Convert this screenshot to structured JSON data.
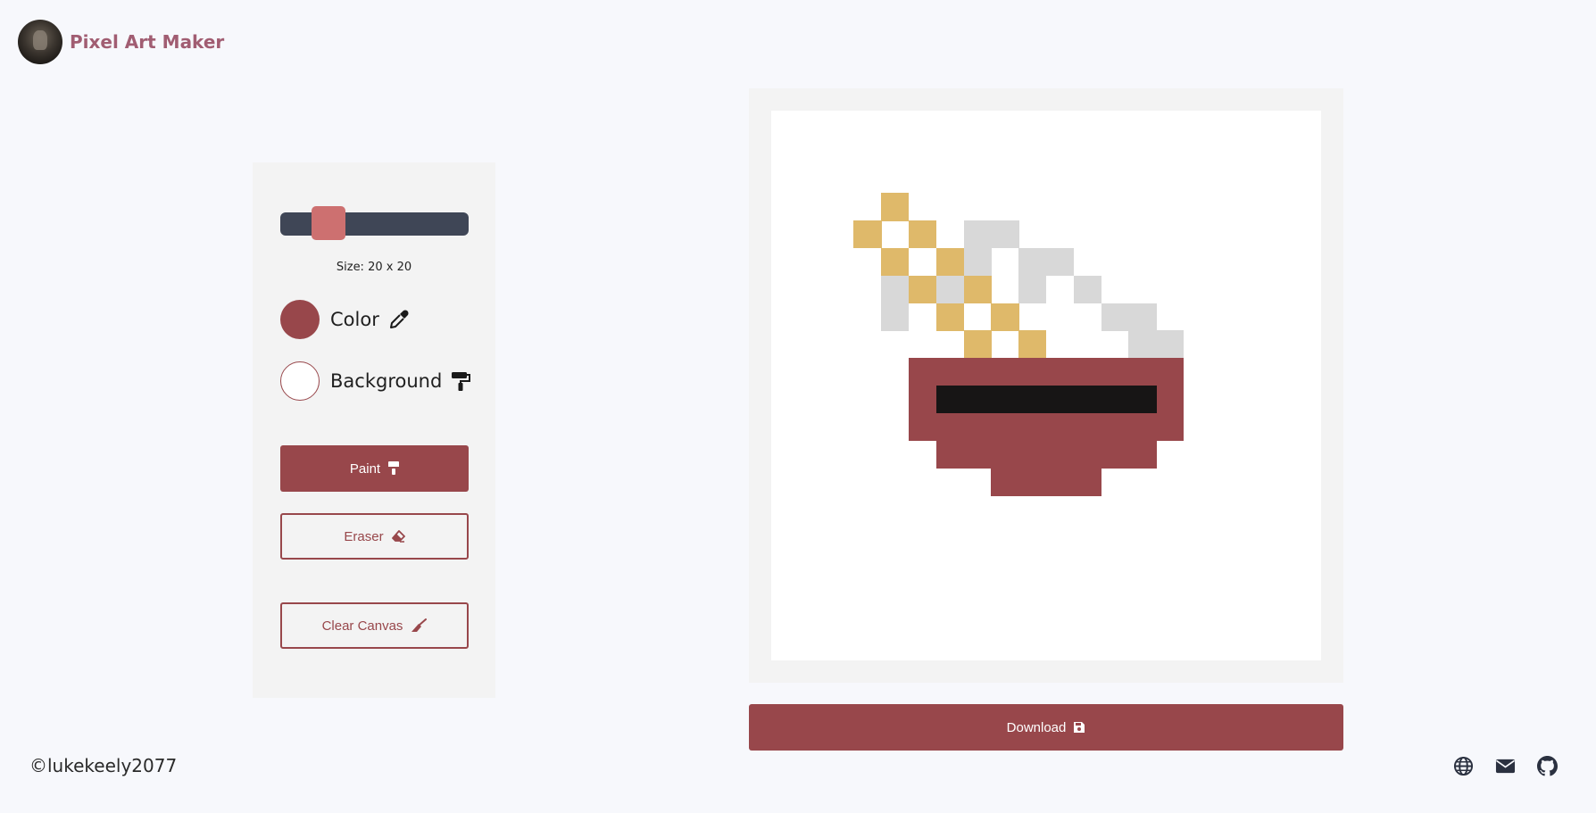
{
  "app": {
    "title": "Pixel Art Maker"
  },
  "controls": {
    "grid_size": {
      "value": 20,
      "min": 10,
      "max": 100,
      "label": "Size: 20 x 20"
    },
    "color": {
      "label": "Color",
      "value": "#98474b",
      "icon": "eyedropper-icon"
    },
    "background": {
      "label": "Background",
      "value": "#ffffff",
      "icon": "paint-roller-icon"
    },
    "paint_button": {
      "label": "Paint",
      "icon": "paintbrush-icon"
    },
    "eraser_button": {
      "label": "Eraser",
      "icon": "eraser-icon"
    },
    "clear_button": {
      "label": "Clear Canvas",
      "icon": "broom-icon"
    }
  },
  "download_button": {
    "label": "Download",
    "icon": "save-icon"
  },
  "footer": {
    "credit": "©lukekeely2077",
    "links": [
      "globe-icon",
      "envelope-icon",
      "github-icon"
    ]
  },
  "colors": {
    "accent": "#98474b",
    "thumb": "#cd7070",
    "slider_track": "#3f4656",
    "gold": "#dfb96a",
    "steam": "#d8d8d8",
    "black": "#171515"
  },
  "canvas": {
    "cols": 20,
    "rows": 20,
    "pixels": [
      [
        "#dfb96a",
        [
          [
            4,
            3
          ],
          [
            3,
            4
          ],
          [
            5,
            4
          ],
          [
            4,
            5
          ],
          [
            6,
            5
          ],
          [
            5,
            6
          ],
          [
            7,
            6
          ],
          [
            6,
            7
          ],
          [
            8,
            7
          ],
          [
            7,
            8
          ],
          [
            9,
            8
          ]
        ]
      ],
      [
        "#d8d8d8",
        [
          [
            7,
            4
          ],
          [
            8,
            4
          ],
          [
            7,
            5
          ],
          [
            9,
            5
          ],
          [
            10,
            5
          ],
          [
            4,
            6
          ],
          [
            6,
            6
          ],
          [
            9,
            6
          ],
          [
            11,
            6
          ],
          [
            4,
            7
          ],
          [
            12,
            7
          ],
          [
            13,
            7
          ],
          [
            13,
            8
          ],
          [
            14,
            8
          ]
        ]
      ],
      [
        "#98474b",
        [
          [
            5,
            9
          ],
          [
            6,
            9
          ],
          [
            7,
            9
          ],
          [
            8,
            9
          ],
          [
            9,
            9
          ],
          [
            10,
            9
          ],
          [
            11,
            9
          ],
          [
            12,
            9
          ],
          [
            13,
            9
          ],
          [
            14,
            9
          ],
          [
            5,
            10
          ],
          [
            14,
            10
          ],
          [
            5,
            11
          ],
          [
            6,
            11
          ],
          [
            7,
            11
          ],
          [
            8,
            11
          ],
          [
            9,
            11
          ],
          [
            10,
            11
          ],
          [
            11,
            11
          ],
          [
            12,
            11
          ],
          [
            13,
            11
          ],
          [
            14,
            11
          ],
          [
            6,
            12
          ],
          [
            7,
            12
          ],
          [
            8,
            12
          ],
          [
            9,
            12
          ],
          [
            10,
            12
          ],
          [
            11,
            12
          ],
          [
            12,
            12
          ],
          [
            13,
            12
          ],
          [
            8,
            13
          ],
          [
            9,
            13
          ],
          [
            10,
            13
          ],
          [
            11,
            13
          ]
        ]
      ],
      [
        "#171515",
        [
          [
            6,
            10
          ],
          [
            7,
            10
          ],
          [
            8,
            10
          ],
          [
            9,
            10
          ],
          [
            10,
            10
          ],
          [
            11,
            10
          ],
          [
            12,
            10
          ],
          [
            13,
            10
          ]
        ]
      ]
    ]
  }
}
